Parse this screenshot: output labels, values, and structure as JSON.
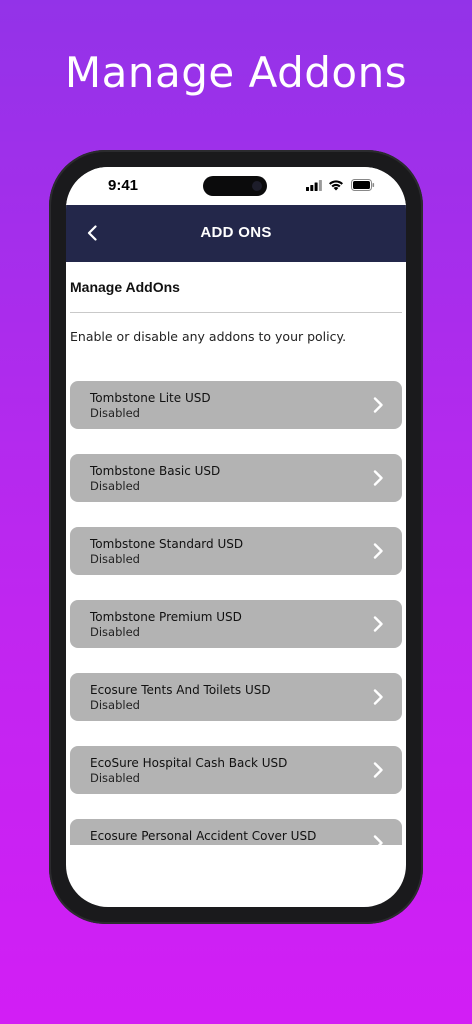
{
  "promo": {
    "title": "Manage Addons"
  },
  "status_bar": {
    "time": "9:41"
  },
  "nav": {
    "title": "ADD ONS",
    "back_icon": "chevron-left-icon"
  },
  "page": {
    "heading": "Manage AddOns",
    "description": "Enable or disable any addons to your policy."
  },
  "addons": [
    {
      "name": "Tombstone Lite USD",
      "status": "Disabled"
    },
    {
      "name": "Tombstone Basic USD",
      "status": "Disabled"
    },
    {
      "name": "Tombstone Standard USD",
      "status": "Disabled"
    },
    {
      "name": "Tombstone Premium USD",
      "status": "Disabled"
    },
    {
      "name": "Ecosure Tents And Toilets USD",
      "status": "Disabled"
    },
    {
      "name": "EcoSure Hospital Cash Back USD",
      "status": "Disabled"
    },
    {
      "name": "Ecosure Personal Accident Cover USD",
      "status": ""
    }
  ],
  "colors": {
    "background_top": "#9333e8",
    "background_bottom": "#d21ef5",
    "nav_bar": "#23274a",
    "card": "#b3b3b3"
  }
}
